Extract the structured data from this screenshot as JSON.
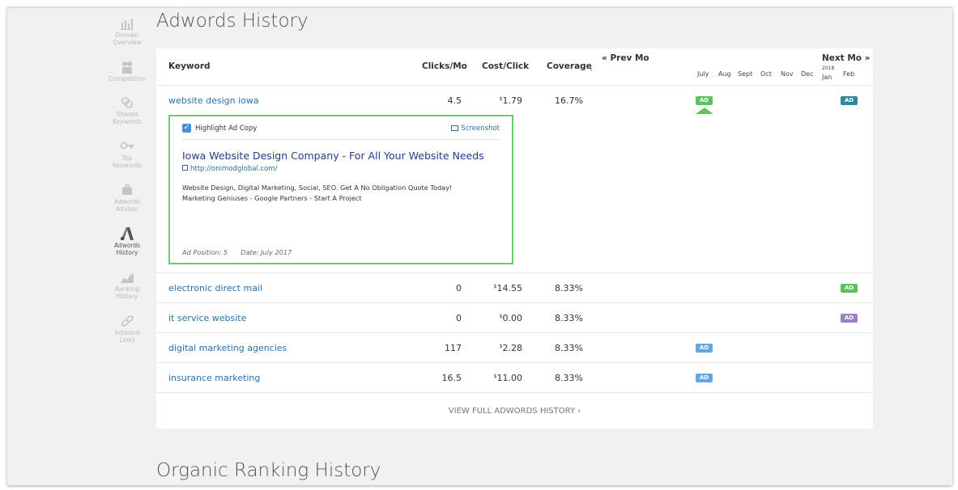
{
  "page_title": "Adwords History",
  "section2_title": "Organic Ranking History",
  "sidebar": {
    "items": [
      {
        "label_1": "Domain",
        "label_2": "Overview",
        "icon": "bar-chart-icon"
      },
      {
        "label_1": "Competition",
        "label_2": "",
        "icon": "people-icon"
      },
      {
        "label_1": "Shared",
        "label_2": "Keywords",
        "icon": "link-circles-icon"
      },
      {
        "label_1": "Top",
        "label_2": "Keywords",
        "icon": "key-icon"
      },
      {
        "label_1": "Adwords",
        "label_2": "Advisor",
        "icon": "briefcase-icon"
      },
      {
        "label_1": "Adwords",
        "label_2": "History",
        "icon": "adwords-logo-icon"
      },
      {
        "label_1": "Ranking",
        "label_2": "History",
        "icon": "area-chart-icon"
      },
      {
        "label_1": "Inbound",
        "label_2": "Links",
        "icon": "chain-link-icon"
      }
    ]
  },
  "table": {
    "headers": {
      "keyword": "Keyword",
      "clicks": "Clicks/Mo",
      "cost": "Cost/Click",
      "coverage": "Coverage"
    },
    "prev": "Prev Mo",
    "next": "Next Mo",
    "prev_icon": "«",
    "next_icon": "»",
    "left_caret": "‹",
    "months": [
      "July",
      "Aug",
      "Sept",
      "Oct",
      "Nov",
      "Dec",
      "Jan",
      "Feb"
    ],
    "year": "2018",
    "ad_label": "AD",
    "rows": [
      {
        "keyword": "website design iowa",
        "clicks": "4.5",
        "cost_sym": "$",
        "cost": "1.79",
        "coverage": "16.7%"
      },
      {
        "keyword": "electronic direct mail",
        "clicks": "0",
        "cost_sym": "$",
        "cost": "14.55",
        "coverage": "8.33%"
      },
      {
        "keyword": "it service website",
        "clicks": "0",
        "cost_sym": "$",
        "cost": "0.00",
        "coverage": "8.33%"
      },
      {
        "keyword": "digital marketing agencies",
        "clicks": "117",
        "cost_sym": "$",
        "cost": "2.28",
        "coverage": "8.33%"
      },
      {
        "keyword": "insurance marketing",
        "clicks": "16.5",
        "cost_sym": "$",
        "cost": "11.00",
        "coverage": "8.33%"
      }
    ],
    "view_all": "VIEW FULL ADWORDS HISTORY ›"
  },
  "ad_copy": {
    "highlight_label": "Highlight Ad Copy",
    "screenshot_label": "Screenshot",
    "title": "Iowa Website Design Company - For All Your Website Needs",
    "url": "http://onimodglobal.com/",
    "desc_1": "Website Design, Digital Marketing, Social, SEO. Get A No Obligation Quote Today!",
    "desc_2": "Marketing Geniuses - Google Partners - Start A Project",
    "position": "Ad Position: 5",
    "date": "Date: July 2017"
  },
  "colors": {
    "ad_green": "#5cc35c",
    "ad_teal": "#2a8a9a",
    "ad_purple": "#9b7fc7",
    "ad_blue": "#63a8e0"
  }
}
